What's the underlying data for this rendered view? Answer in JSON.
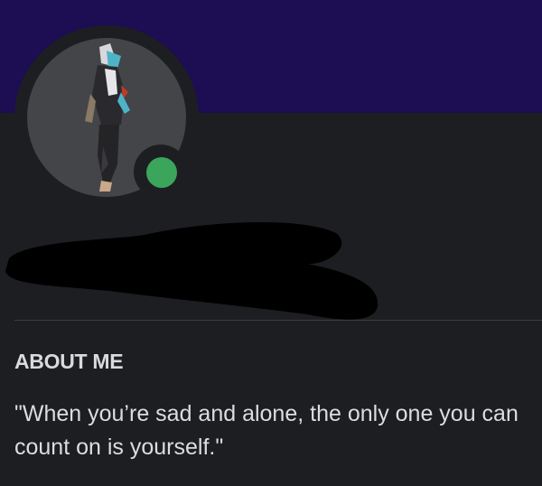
{
  "profile": {
    "banner_color": "#1d0d52",
    "status": "online",
    "status_color": "#3ba55c",
    "avatar_icon": "avatar-character-art-icon",
    "username_redacted": true
  },
  "about_section": {
    "heading": "ABOUT ME",
    "bio": "\"When you’re sad and alone, the only one you can count on is yourself.\""
  }
}
